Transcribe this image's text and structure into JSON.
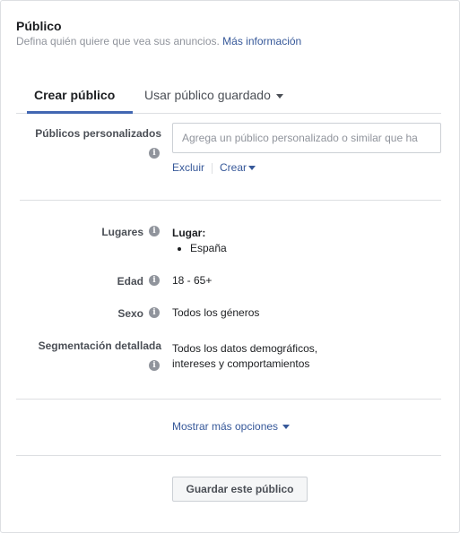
{
  "header": {
    "title": "Público",
    "subtitle": "Defina quién quiere que vea sus anuncios.",
    "more_info_link": "Más información"
  },
  "tabs": [
    {
      "label": "Crear público",
      "active": true
    },
    {
      "label": "Usar público guardado",
      "active": false
    }
  ],
  "custom_audiences": {
    "label": "Públicos personalizados",
    "input_value": "",
    "input_placeholder": "Agrega un público personalizado o similar que ha",
    "exclude_link": "Excluir",
    "create_link": "Crear"
  },
  "locations": {
    "label": "Lugares",
    "heading": "Lugar:",
    "items": [
      "España"
    ]
  },
  "age": {
    "label": "Edad",
    "value": "18 - 65+"
  },
  "gender": {
    "label": "Sexo",
    "value": "Todos los géneros"
  },
  "detailed_targeting": {
    "label": "Segmentación detallada",
    "value_line1": "Todos los datos demográficos,",
    "value_line2": "intereses y comportamientos"
  },
  "more_options_link": "Mostrar más opciones",
  "save_button": "Guardar este público",
  "colors": {
    "link": "#365899",
    "tab_underline": "#4267b2",
    "border": "#dddfe2",
    "muted_text": "#90949c"
  },
  "icons": {
    "info": "info-circle-icon",
    "dropdown": "caret-down-icon"
  }
}
